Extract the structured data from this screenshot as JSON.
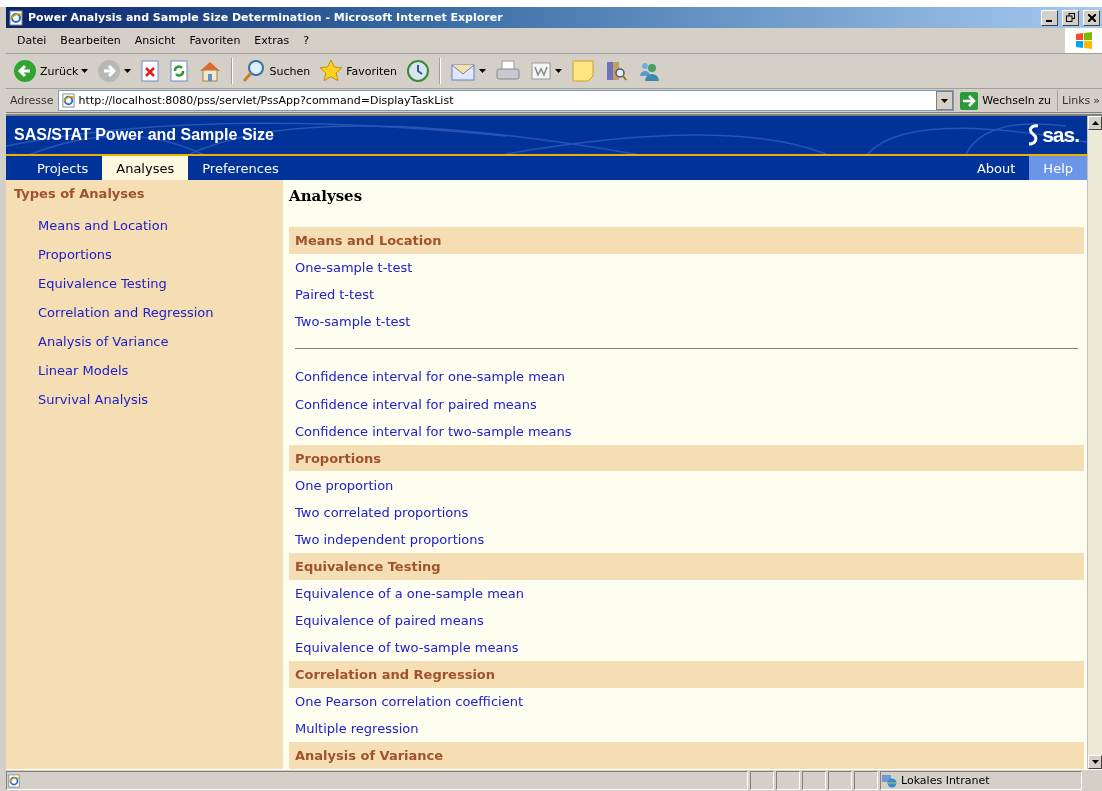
{
  "window": {
    "title": "Power Analysis and Sample Size Determination - Microsoft Internet Explorer"
  },
  "menu": [
    "Datei",
    "Bearbeiten",
    "Ansicht",
    "Favoriten",
    "Extras",
    "?"
  ],
  "toolbar": [
    {
      "kind": "back",
      "label": "Zurück"
    },
    {
      "kind": "forward"
    },
    {
      "kind": "stop"
    },
    {
      "kind": "refresh"
    },
    {
      "kind": "home"
    },
    {
      "kind": "separator"
    },
    {
      "kind": "search",
      "label": "Suchen"
    },
    {
      "kind": "favorites",
      "label": "Favoriten"
    },
    {
      "kind": "history"
    },
    {
      "kind": "separator"
    },
    {
      "kind": "mail"
    },
    {
      "kind": "print"
    },
    {
      "kind": "edit"
    },
    {
      "kind": "note"
    },
    {
      "kind": "research"
    },
    {
      "kind": "messenger"
    }
  ],
  "address": {
    "label": "Adresse",
    "value": "http://localhost:8080/pss/servlet/PssApp?command=DisplayTaskList",
    "go": "Wechseln zu",
    "links": "Links",
    "more": "»"
  },
  "app": {
    "title": "SAS/STAT Power and Sample Size",
    "logo_text": "sas."
  },
  "nav": {
    "tabs": [
      {
        "label": "Projects",
        "selected": false
      },
      {
        "label": "Analyses",
        "selected": true
      },
      {
        "label": "Preferences",
        "selected": false
      }
    ],
    "right": [
      {
        "label": "About",
        "selected": false
      },
      {
        "label": "Help",
        "selected": true
      }
    ]
  },
  "sidebar": {
    "heading": "Types of Analyses",
    "items": [
      "Means and Location",
      "Proportions",
      "Equivalence Testing",
      "Correlation and Regression",
      "Analysis of Variance",
      "Linear Models",
      "Survival Analysis"
    ]
  },
  "main": {
    "heading": "Analyses",
    "sections": [
      {
        "title": "Means and Location",
        "groups": [
          [
            "One-sample t-test",
            "Paired t-test",
            "Two-sample t-test"
          ],
          [
            "Confidence interval for one-sample mean",
            "Confidence interval for paired means",
            "Confidence interval for two-sample means"
          ]
        ]
      },
      {
        "title": "Proportions",
        "groups": [
          [
            "One proportion",
            "Two correlated proportions",
            "Two independent proportions"
          ]
        ]
      },
      {
        "title": "Equivalence Testing",
        "groups": [
          [
            "Equivalence of a one-sample mean",
            "Equivalence of paired means",
            "Equivalence of two-sample means"
          ]
        ]
      },
      {
        "title": "Correlation and Regression",
        "groups": [
          [
            "One Pearson correlation coefficient",
            "Multiple regression"
          ]
        ]
      },
      {
        "title": "Analysis of Variance"
      }
    ]
  },
  "status_bar": {
    "zone": "Lokales Intranet"
  }
}
